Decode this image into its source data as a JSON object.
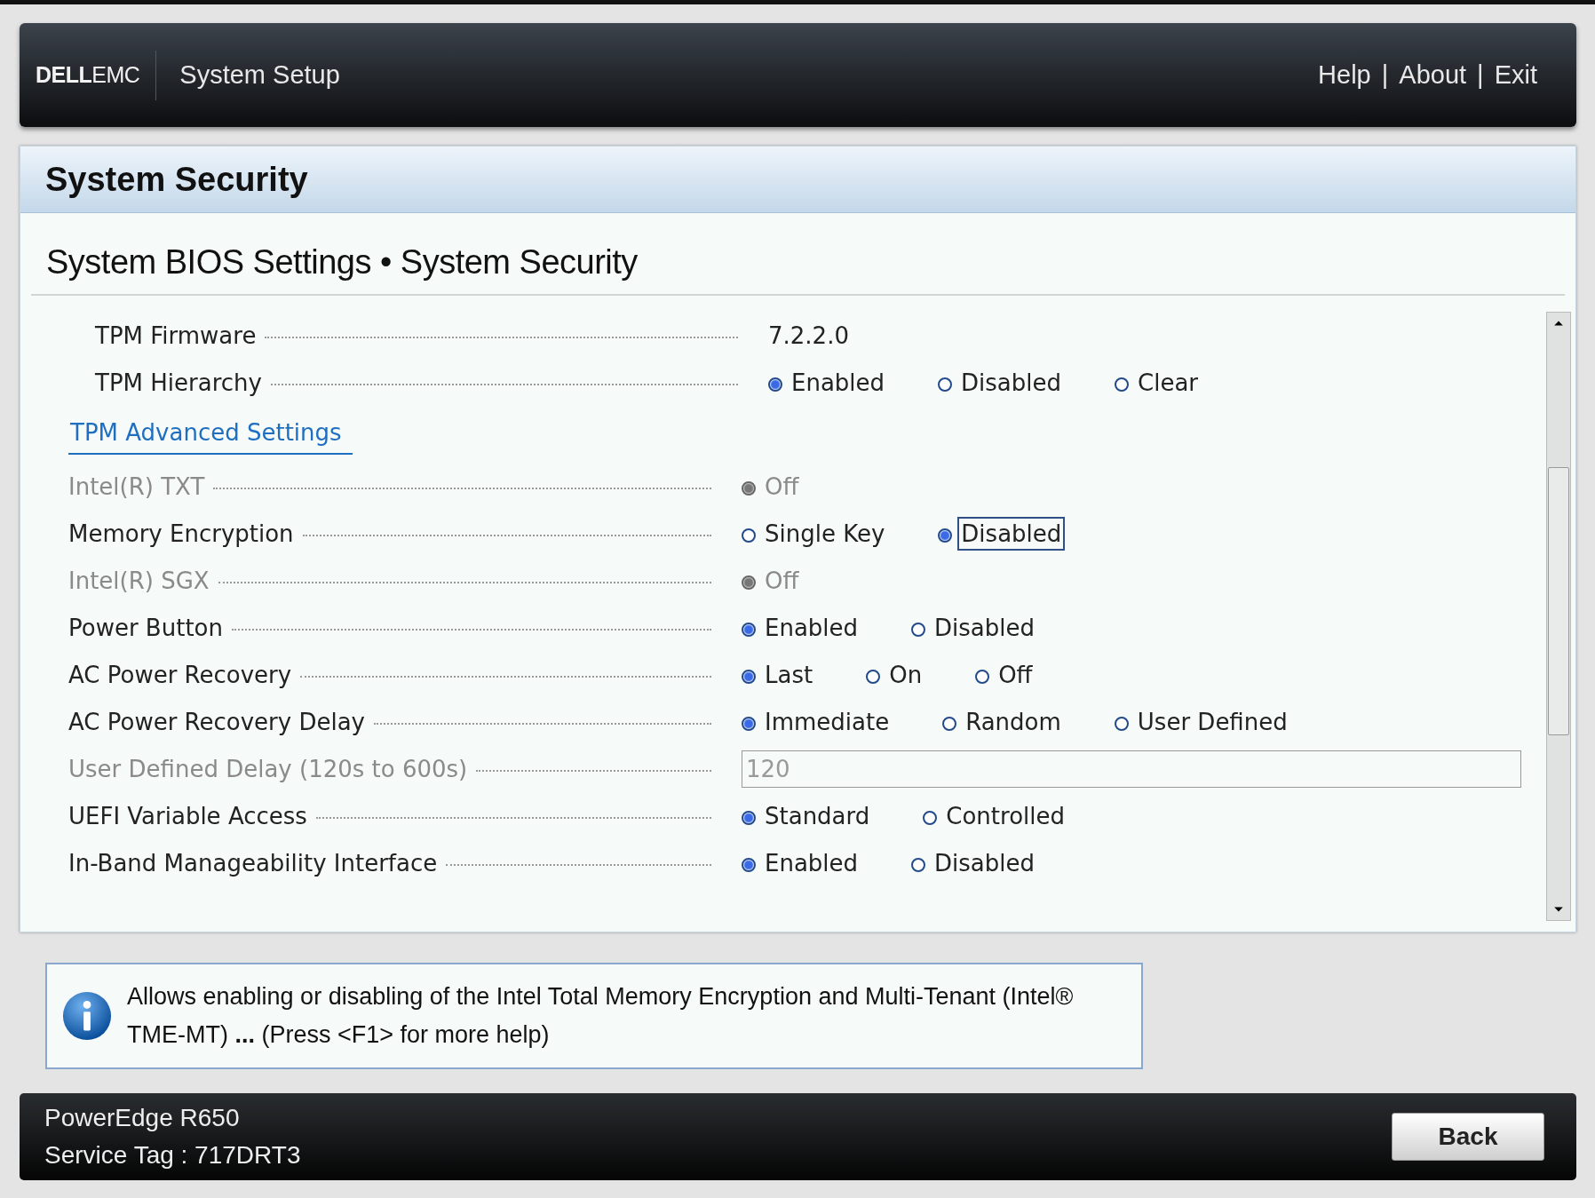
{
  "header": {
    "logo": "**DELL**EMC",
    "title": "System Setup",
    "links": [
      {
        "label": "Help"
      },
      {
        "label": "About"
      },
      {
        "label": "Exit"
      }
    ],
    "separator": "|"
  },
  "page_title": "System Security",
  "breadcrumb": "System BIOS Settings • System Security",
  "tpm_rows": [
    {
      "label": "TPM Firmware",
      "kind": "value",
      "disabled": false,
      "value": "7.2.2.0"
    },
    {
      "label": "TPM Hierarchy",
      "kind": "radio",
      "disabled": false,
      "options": [
        {
          "label": "Enabled",
          "selected": true,
          "focused": false
        },
        {
          "label": "Disabled",
          "selected": false,
          "focused": false
        },
        {
          "label": "Clear",
          "selected": false,
          "focused": false
        }
      ]
    }
  ],
  "advanced_link": "TPM Advanced Settings",
  "rows": [
    {
      "label": "Intel(R) TXT",
      "kind": "radio",
      "disabled": true,
      "options": [
        {
          "label": "Off",
          "selected": true,
          "focused": false
        }
      ]
    },
    {
      "label": "Memory Encryption",
      "kind": "radio",
      "disabled": false,
      "options": [
        {
          "label": "Single Key",
          "selected": false,
          "focused": false
        },
        {
          "label": "Disabled",
          "selected": true,
          "focused": true
        }
      ]
    },
    {
      "label": "Intel(R) SGX",
      "kind": "radio",
      "disabled": true,
      "options": [
        {
          "label": "Off",
          "selected": true,
          "focused": false
        }
      ]
    },
    {
      "label": "Power Button",
      "kind": "radio",
      "disabled": false,
      "options": [
        {
          "label": "Enabled",
          "selected": true,
          "focused": false
        },
        {
          "label": "Disabled",
          "selected": false,
          "focused": false
        }
      ]
    },
    {
      "label": "AC Power Recovery",
      "kind": "radio",
      "disabled": false,
      "options": [
        {
          "label": "Last",
          "selected": true,
          "focused": false
        },
        {
          "label": "On",
          "selected": false,
          "focused": false
        },
        {
          "label": "Off",
          "selected": false,
          "focused": false
        }
      ]
    },
    {
      "label": "AC Power Recovery Delay",
      "kind": "radio",
      "disabled": false,
      "options": [
        {
          "label": "Immediate",
          "selected": true,
          "focused": false
        },
        {
          "label": "Random",
          "selected": false,
          "focused": false
        },
        {
          "label": "User Defined",
          "selected": false,
          "focused": false
        }
      ]
    },
    {
      "label": "User Defined Delay (120s to 600s)",
      "kind": "field",
      "disabled": true,
      "value": "120"
    },
    {
      "label": "UEFI Variable Access",
      "kind": "radio",
      "disabled": false,
      "options": [
        {
          "label": "Standard",
          "selected": true,
          "focused": false
        },
        {
          "label": "Controlled",
          "selected": false,
          "focused": false
        }
      ]
    },
    {
      "label": "In-Band Manageability Interface",
      "kind": "radio",
      "disabled": false,
      "options": [
        {
          "label": "Enabled",
          "selected": true,
          "focused": false
        },
        {
          "label": "Disabled",
          "selected": false,
          "focused": false
        }
      ]
    }
  ],
  "help_text": "Allows enabling or disabling of the Intel Total Memory Encryption and Multi-Tenant (Intel® TME-MT) **...** (Press <F1> for more help)",
  "footer": {
    "model": "PowerEdge R650",
    "service_tag": "Service Tag : 717DRT3",
    "button": "Back"
  }
}
